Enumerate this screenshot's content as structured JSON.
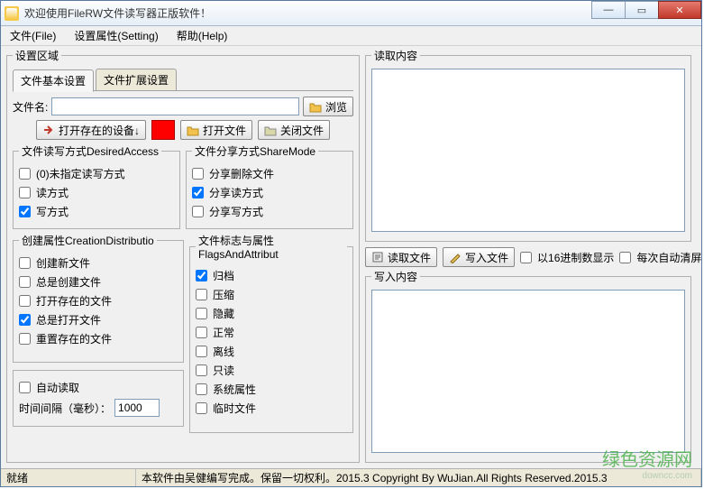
{
  "window": {
    "title": "欢迎使用FileRW文件读写器正版软件！"
  },
  "menu": {
    "file": "文件(File)",
    "setting": "设置属性(Setting)",
    "help": "帮助(Help)"
  },
  "left": {
    "group_title": "设置区域",
    "tabs": {
      "basic": "文件基本设置",
      "ext": "文件扩展设置"
    },
    "filename_label": "文件名:",
    "filename_value": "",
    "browse": "浏览",
    "open_device": "打开存在的设备↓",
    "open_file": "打开文件",
    "close_file": "关闭文件",
    "access": {
      "legend": "文件读写方式DesiredAccess",
      "none": "(0)未指定读写方式",
      "none_checked": false,
      "read": "读方式",
      "read_checked": false,
      "write": "写方式",
      "write_checked": true
    },
    "share": {
      "legend": "文件分享方式ShareMode",
      "delete": "分享删除文件",
      "delete_checked": false,
      "read": "分享读方式",
      "read_checked": true,
      "write": "分享写方式",
      "write_checked": false
    },
    "creation": {
      "legend": "创建属性CreationDistributio",
      "create_new": "创建新文件",
      "create_new_checked": false,
      "create_always": "总是创建文件",
      "create_always_checked": false,
      "open_existing": "打开存在的文件",
      "open_existing_checked": false,
      "open_always": "总是打开文件",
      "open_always_checked": true,
      "truncate": "重置存在的文件",
      "truncate_checked": false
    },
    "flags": {
      "legend": "文件标志与属性FlagsAndAttribut",
      "archive": "归档",
      "archive_checked": true,
      "compressed": "压缩",
      "compressed_checked": false,
      "hidden": "隐藏",
      "hidden_checked": false,
      "normal": "正常",
      "normal_checked": false,
      "offline": "离线",
      "offline_checked": false,
      "readonly": "只读",
      "readonly_checked": false,
      "system": "系统属性",
      "system_checked": false,
      "temp": "临时文件",
      "temp_checked": false
    },
    "autoread": {
      "label": "自动读取",
      "checked": false,
      "interval_label": "时间间隔（毫秒）：",
      "interval_value": "1000"
    }
  },
  "right": {
    "read_legend": "读取内容",
    "read_btn": "读取文件",
    "write_btn": "写入文件",
    "hex_label": "以16进制数显示",
    "hex_checked": false,
    "autoclear_label": "每次自动清屏",
    "autoclear_checked": false,
    "write_legend": "写入内容"
  },
  "status": {
    "ready": "就绪",
    "copyright": "本软件由吴健编写完成。保留一切权利。2015.3 Copyright By WuJian.All Rights Reserved.2015.3"
  },
  "watermark": {
    "main": "绿色资源网",
    "sub": "downcc.com"
  }
}
